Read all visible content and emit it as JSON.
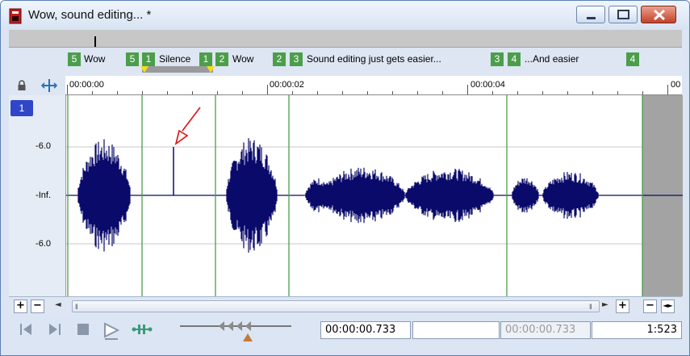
{
  "window": {
    "title": "Wow, sound editing... *"
  },
  "markers": [
    {
      "num": "5",
      "label": "Wow"
    },
    {
      "num": "5",
      "label": ""
    },
    {
      "num": "1",
      "label": "Silence"
    },
    {
      "num": "1",
      "label": ""
    },
    {
      "num": "2",
      "label": "Wow"
    },
    {
      "num": "2",
      "label": ""
    },
    {
      "num": "3",
      "label": "Sound editing just gets easier..."
    },
    {
      "num": "3",
      "label": ""
    },
    {
      "num": "4",
      "label": "...And easier"
    },
    {
      "num": "4",
      "label": ""
    }
  ],
  "ruler": {
    "labels": [
      "00:00:00",
      "00:00:02",
      "00:00:04",
      "00"
    ]
  },
  "channel": {
    "badge": "1",
    "db_labels": [
      "-6.0",
      "-Inf.",
      "-6.0"
    ]
  },
  "scrollbar": {
    "zoom_in": "+",
    "zoom_out": "−",
    "left_arrow": "◄",
    "right_arrow": "►",
    "v_zoom_in": "+",
    "v_zoom_out": "−",
    "fit": "◄►"
  },
  "transport": {
    "cursor_time": "00:00:00.733",
    "selection_start": "",
    "selection_end": "00:00:00.733",
    "zoom_ratio": "1:523"
  },
  "colors": {
    "waveform": "#0a0a6b",
    "marker": "#4c9e4a",
    "region_tri": "#f5dc1c",
    "annotation_arrow": "#e01010"
  }
}
